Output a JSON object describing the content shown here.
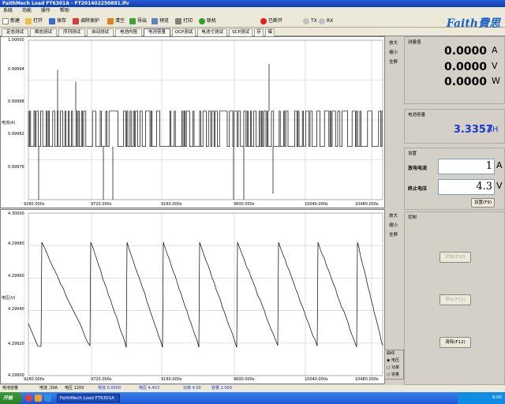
{
  "window": {
    "title": "FaithMech Load FT6301A - FT201402250881.lfv"
  },
  "menu": [
    "系统",
    "功能",
    "操作",
    "帮助"
  ],
  "toolbar": {
    "items": [
      {
        "label": "新建",
        "icon": "new-icon",
        "color": "#ffffff"
      },
      {
        "label": "打开",
        "icon": "open-icon",
        "color": "#f0c040"
      },
      {
        "label": "保存",
        "icon": "save-icon",
        "color": "#3a6ad0"
      },
      {
        "label": "调除保护",
        "icon": "protect-icon",
        "color": "#d04040"
      },
      {
        "label": "清空",
        "icon": "clear-icon",
        "color": "#e08020"
      },
      {
        "label": "导出",
        "icon": "export-icon",
        "color": "#40a040"
      },
      {
        "label": "预览",
        "icon": "preview-icon",
        "color": "#6080c0"
      },
      {
        "label": "打印",
        "icon": "print-icon",
        "color": "#808080"
      },
      {
        "label": "联机",
        "icon": "connect-icon",
        "color": "#30a030"
      },
      {
        "label": "已断开",
        "icon": "disconnect-icon",
        "color": "#e02020"
      },
      {
        "label": "TX",
        "icon": "tx-led-icon",
        "color": "#c0c0c0"
      },
      {
        "label": "RX",
        "icon": "rx-led-icon",
        "color": "#c0c0c0"
      }
    ],
    "brand": "Faith費思"
  },
  "tabs": [
    "定态测试",
    "瞬态测试",
    "序列测试",
    "自动测试",
    "电池内阻",
    "电池容量",
    "OCP测试",
    "电池寸测试",
    "SCP测试",
    "存",
    "储"
  ],
  "active_tab": 5,
  "chart_top": {
    "ylabel": "电流(A)",
    "yticks": [
      "1.00000",
      "0.99994",
      "0.99988",
      "0.99982",
      "0.99976"
    ],
    "xticks": [
      "9280.000s",
      "9720.000s",
      "9160.000s",
      "9600.000s",
      "10040.000s",
      "10480.000s"
    ],
    "controls": [
      "放大",
      "缩小",
      "全屏"
    ]
  },
  "chart_bottom": {
    "ylabel": "电压(V)",
    "yticks": [
      "4.30000",
      "4.29980",
      "4.29960",
      "4.29940",
      "4.29920",
      "4.29900"
    ],
    "xticks": [
      "9280.000s",
      "9720.000s",
      "9160.000s",
      "9600.000s",
      "10040.000s",
      "10480.000s"
    ],
    "controls": [
      "放大",
      "缩小",
      "全屏"
    ],
    "legend": {
      "title": "曲线",
      "options": [
        "电压",
        "功率",
        "容量"
      ],
      "selected": 0
    }
  },
  "chart_data": [
    {
      "type": "line",
      "title": "",
      "xlabel": "",
      "ylabel": "电流(A)",
      "ylim": [
        0.99973,
        1.0
      ],
      "series": [
        {
          "values": [
            0.99982,
            0.99988,
            0.99985,
            0.99982,
            0.99988,
            0.99985,
            0.99982,
            0.99988
          ]
        }
      ]
    },
    {
      "type": "line",
      "title": "",
      "xlabel": "",
      "ylabel": "电压(V)",
      "ylim": [
        4.299,
        4.3
      ],
      "series": [
        {
          "values": [
            4.29976,
            4.29968,
            4.29941,
            4.29933,
            4.29945,
            4.29921,
            4.2998,
            4.2993
          ]
        }
      ]
    }
  ],
  "readings": {
    "title": "测量值",
    "current": "0.0000",
    "current_unit": "A",
    "voltage": "0.0000",
    "voltage_unit": "V",
    "power": "0.0000",
    "power_unit": "W"
  },
  "capacity": {
    "title": "电池容量",
    "value": "3.3357",
    "unit": "AH"
  },
  "settings": {
    "title": "设置",
    "discharge_label": "放电电流",
    "discharge_value": "1",
    "discharge_unit": "A",
    "stop_label": "终止电压",
    "stop_value": "4.3",
    "stop_unit": "V",
    "set_button": "设置(F9)"
  },
  "control": {
    "title": "控制",
    "start_button": "开始(F10)",
    "stop_button": "停止(F11)",
    "clear_button": "清除(F12)"
  },
  "status": {
    "items": [
      "电池容量",
      "电流 ,30A",
      "电压 120V",
      "电流 0.0000",
      "电压 4.4V2",
      "功率 4.00",
      "容量 2.000"
    ]
  },
  "taskbar": {
    "start": "开始",
    "task": "FaithMech Load FT6301A",
    "clock": "9:00"
  }
}
